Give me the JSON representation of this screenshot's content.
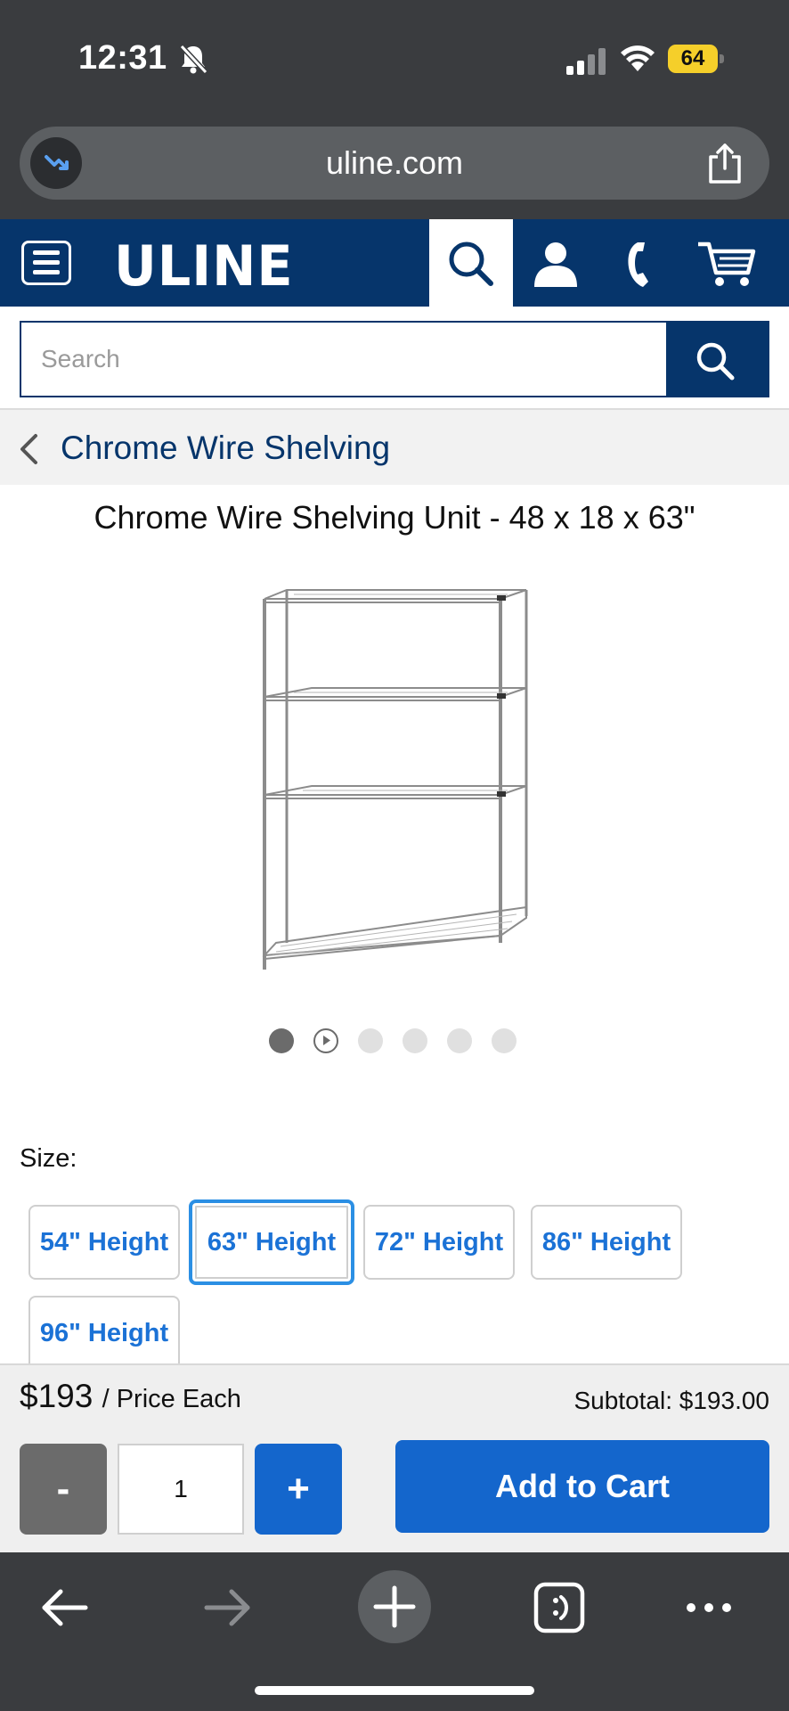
{
  "status_bar": {
    "time": "12:31",
    "battery": "64",
    "battery_color": "#f5cf2a"
  },
  "browser": {
    "url": "uline.com"
  },
  "header": {
    "logo": "ULINE",
    "brand_color": "#06356b",
    "icons": [
      "menu-icon",
      "search-icon",
      "account-icon",
      "phone-icon",
      "cart-icon"
    ]
  },
  "search": {
    "placeholder": "Search"
  },
  "breadcrumb": {
    "label": "Chrome Wire Shelving"
  },
  "product": {
    "title": "Chrome Wire Shelving Unit - 48 x 18 x 63\"",
    "image_icon": "wire-shelving-image",
    "gallery_count": 6,
    "gallery_active_index": 0,
    "gallery_video_index": 1
  },
  "size": {
    "label": "Size:",
    "options": [
      "54\" Height",
      "63\" Height",
      "72\" Height",
      "86\" Height",
      "96\" Height"
    ],
    "selected_index": 1
  },
  "pricing": {
    "price": "$193",
    "price_suffix": "/ Price Each",
    "subtotal": "Subtotal: $193.00",
    "quantity": "1",
    "minus_label": "-",
    "plus_label": "+",
    "add_to_cart_label": "Add to Cart",
    "action_color": "#1466cc"
  },
  "toolbar": {
    "icons": [
      "back-arrow-icon",
      "forward-arrow-icon",
      "new-tab-plus-icon",
      "tabs-icon",
      "more-icon"
    ]
  }
}
